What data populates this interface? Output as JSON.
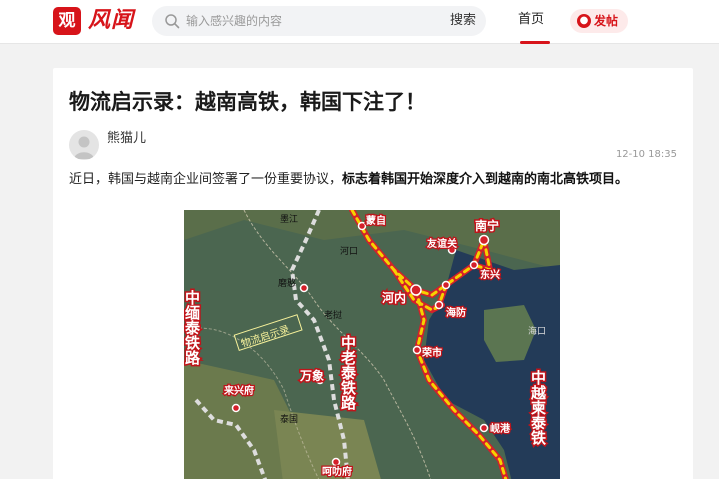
{
  "header": {
    "logo_char": "观",
    "logo_text": "风闻",
    "search_placeholder": "输入感兴趣的内容",
    "search_button": "搜索",
    "nav_home": "首页",
    "post_button": "发帖",
    "accent_color": "#d7141a"
  },
  "article": {
    "title": "物流启示录：越南高铁，韩国下注了！",
    "author": "熊猫儿",
    "time": "12-10 18:35",
    "intro_plain": "近日，韩国与越南企业间签署了一份重要协议，",
    "intro_bold": "标志着韩国开始深度介入到越南的南北高铁项目。"
  },
  "map": {
    "labels": {
      "mengzi": "蒙自",
      "nanning": "南宁",
      "youyiguan": "友谊关",
      "dongxing": "东兴",
      "hekou": "河口",
      "moxiang": "墨江",
      "hanoi": "河内",
      "haifang": "海防",
      "haikou": "海口",
      "yongshi": "荣市",
      "xianggang": "岘港",
      "wanxiang": "万象",
      "laixingfu": "来兴府",
      "taiguo": "泰国",
      "kelafu": "呵叻府",
      "boluo": "磨憨",
      "wuliu": "物流启示录",
      "zhongmian": "中缅泰铁路",
      "zhonglao": "中老泰铁路",
      "zhongyue": "中越柬泰铁",
      "laos": "老挝"
    }
  }
}
